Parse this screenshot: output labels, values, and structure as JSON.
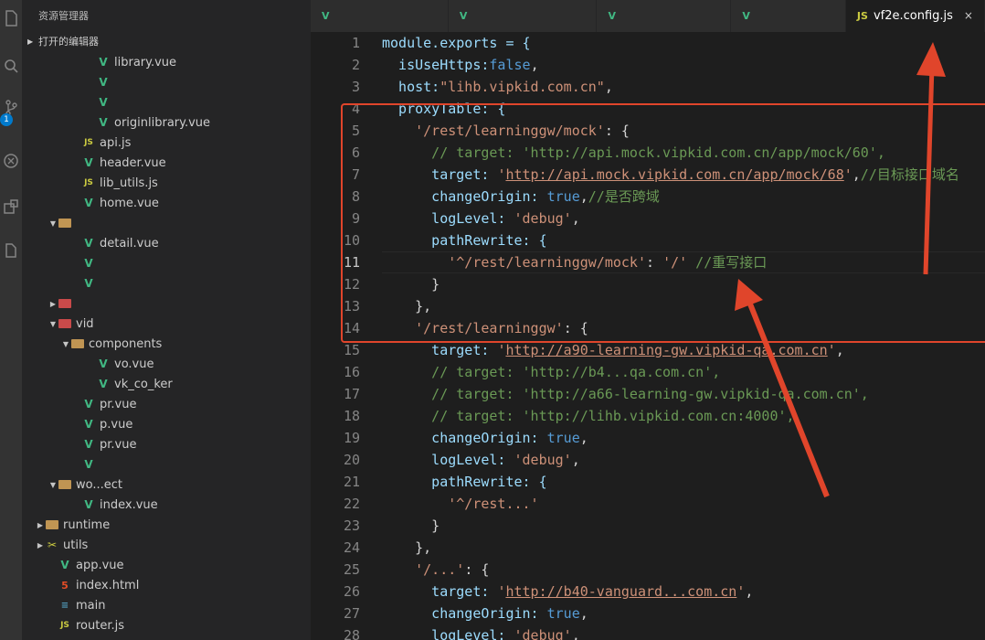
{
  "explorer": {
    "title": "资源管理器",
    "open_editors": "打开的编辑器",
    "tree": [
      {
        "label": "library.vue",
        "indent": 84,
        "icon": "vue",
        "twisty": ""
      },
      {
        "label": "",
        "indent": 84,
        "icon": "vue",
        "twisty": ""
      },
      {
        "label": "",
        "indent": 84,
        "icon": "vue",
        "twisty": ""
      },
      {
        "label": "originlibrary.vue",
        "indent": 84,
        "icon": "vue",
        "twisty": ""
      },
      {
        "label": "api.js",
        "indent": 68,
        "icon": "js",
        "twisty": ""
      },
      {
        "label": "header.vue",
        "indent": 68,
        "icon": "vue",
        "twisty": ""
      },
      {
        "label": "lib_utils.js",
        "indent": 68,
        "icon": "js",
        "twisty": ""
      },
      {
        "label": "home.vue",
        "indent": 68,
        "icon": "vue",
        "twisty": ""
      },
      {
        "label": "",
        "indent": 42,
        "icon": "folder",
        "twisty": "▼"
      },
      {
        "label": "detail.vue",
        "indent": 68,
        "icon": "vue",
        "twisty": ""
      },
      {
        "label": "",
        "indent": 68,
        "icon": "vue",
        "twisty": ""
      },
      {
        "label": "",
        "indent": 68,
        "icon": "vue",
        "twisty": ""
      },
      {
        "label": "",
        "indent": 42,
        "icon": "folder-red",
        "twisty": "▶"
      },
      {
        "label": "vid",
        "indent": 42,
        "icon": "folder-red",
        "twisty": "▼"
      },
      {
        "label": "components",
        "indent": 56,
        "icon": "folder",
        "twisty": "▼"
      },
      {
        "label": "vo.vue",
        "indent": 84,
        "icon": "vue",
        "twisty": ""
      },
      {
        "label": "vk_co_ker",
        "indent": 84,
        "icon": "vue",
        "twisty": ""
      },
      {
        "label": "pr.vue",
        "indent": 68,
        "icon": "vue",
        "twisty": ""
      },
      {
        "label": "p.vue",
        "indent": 68,
        "icon": "vue",
        "twisty": ""
      },
      {
        "label": "pr.vue",
        "indent": 68,
        "icon": "vue",
        "twisty": ""
      },
      {
        "label": "",
        "indent": 68,
        "icon": "vue",
        "twisty": ""
      },
      {
        "label": "wo...ect",
        "indent": 42,
        "icon": "folder",
        "twisty": "▼"
      },
      {
        "label": "index.vue",
        "indent": 68,
        "icon": "vue",
        "twisty": ""
      },
      {
        "label": "runtime",
        "indent": 28,
        "icon": "folder",
        "twisty": "▶"
      },
      {
        "label": "utils",
        "indent": 28,
        "icon": "tool",
        "twisty": "▶"
      },
      {
        "label": "app.vue",
        "indent": 42,
        "icon": "vue",
        "twisty": ""
      },
      {
        "label": "index.html",
        "indent": 42,
        "icon": "html",
        "twisty": ""
      },
      {
        "label": "main",
        "indent": 42,
        "icon": "md",
        "twisty": ""
      },
      {
        "label": "router.js",
        "indent": 42,
        "icon": "js",
        "twisty": ""
      }
    ]
  },
  "activity_bar": {
    "icons": [
      "files-icon",
      "search-icon",
      "source-control-icon",
      "debug-icon",
      "extensions-icon",
      "remote-icon"
    ],
    "scm_badge": "1"
  },
  "tabs": [
    {
      "label": "",
      "icon": "vue",
      "active": false
    },
    {
      "label": "",
      "icon": "vue",
      "active": false
    },
    {
      "label": "",
      "icon": "vue",
      "active": false
    },
    {
      "label": "",
      "icon": "vue",
      "active": false
    },
    {
      "label": "vf2e.config.js",
      "icon": "js",
      "active": true,
      "close": "×"
    }
  ],
  "editor": {
    "active_line": 11,
    "line_numbers": [
      "1",
      "2",
      "3",
      "4",
      "5",
      "6",
      "7",
      "8",
      "9",
      "10",
      "11",
      "12",
      "13",
      "14",
      "15",
      "16",
      "17",
      "18",
      "19",
      "20",
      "21",
      "22",
      "23",
      "24",
      "25",
      "26",
      "27",
      "28"
    ],
    "lines": [
      [
        {
          "t": "module.exports = {",
          "c": "k"
        }
      ],
      [
        {
          "t": "  isUseHttps:",
          "c": "k"
        },
        {
          "t": "false",
          "c": "b"
        },
        {
          "t": ",",
          "c": "p"
        }
      ],
      [
        {
          "t": "  host:",
          "c": "k"
        },
        {
          "t": "\"lihb.vipkid.com.cn\"",
          "c": "s"
        },
        {
          "t": ",",
          "c": "p"
        }
      ],
      [
        {
          "t": "  proxyTable: {",
          "c": "k"
        }
      ],
      [
        {
          "t": "    ",
          "c": "p"
        },
        {
          "t": "'/rest/learninggw/mock'",
          "c": "s"
        },
        {
          "t": ": {",
          "c": "p"
        }
      ],
      [
        {
          "t": "      // target: 'http://api.mock.vipkid.com.cn/app/mock/60',",
          "c": "c"
        }
      ],
      [
        {
          "t": "      target: ",
          "c": "k"
        },
        {
          "t": "'",
          "c": "s"
        },
        {
          "t": "http://api.mock.vipkid.com.cn/app/mock/68",
          "c": "s u"
        },
        {
          "t": "'",
          "c": "s"
        },
        {
          "t": ",",
          "c": "p"
        },
        {
          "t": "//目标接口域名",
          "c": "c"
        }
      ],
      [
        {
          "t": "      changeOrigin: ",
          "c": "k"
        },
        {
          "t": "true",
          "c": "b"
        },
        {
          "t": ",",
          "c": "p"
        },
        {
          "t": "//是否跨域",
          "c": "c"
        }
      ],
      [
        {
          "t": "      logLevel: ",
          "c": "k"
        },
        {
          "t": "'debug'",
          "c": "s"
        },
        {
          "t": ",",
          "c": "p"
        }
      ],
      [
        {
          "t": "      pathRewrite: {",
          "c": "k"
        }
      ],
      [
        {
          "t": "        ",
          "c": "p"
        },
        {
          "t": "'^/rest/learninggw/mock'",
          "c": "s"
        },
        {
          "t": ": ",
          "c": "p"
        },
        {
          "t": "'/'",
          "c": "s"
        },
        {
          "t": " //重写接口",
          "c": "c"
        }
      ],
      [
        {
          "t": "      }",
          "c": "p"
        }
      ],
      [
        {
          "t": "    },",
          "c": "p"
        }
      ],
      [
        {
          "t": "    ",
          "c": "p"
        },
        {
          "t": "'/rest/learninggw'",
          "c": "s"
        },
        {
          "t": ": {",
          "c": "p"
        }
      ],
      [
        {
          "t": "      target: ",
          "c": "k"
        },
        {
          "t": "'",
          "c": "s"
        },
        {
          "t": "http://a90-learning-gw.vipkid-qa.com.cn",
          "c": "s u"
        },
        {
          "t": "'",
          "c": "s"
        },
        {
          "t": ",",
          "c": "p"
        }
      ],
      [
        {
          "t": "      // target: 'http://b4...qa.com.cn',",
          "c": "c"
        }
      ],
      [
        {
          "t": "      // target: 'http://a66-learning-gw.vipkid-qa.com.cn',",
          "c": "c"
        }
      ],
      [
        {
          "t": "      // target: 'http://lihb.vipkid.com.cn:4000',",
          "c": "c"
        }
      ],
      [
        {
          "t": "      changeOrigin: ",
          "c": "k"
        },
        {
          "t": "true",
          "c": "b"
        },
        {
          "t": ",",
          "c": "p"
        }
      ],
      [
        {
          "t": "      logLevel: ",
          "c": "k"
        },
        {
          "t": "'debug'",
          "c": "s"
        },
        {
          "t": ",",
          "c": "p"
        }
      ],
      [
        {
          "t": "      pathRewrite: {",
          "c": "k"
        }
      ],
      [
        {
          "t": "        ",
          "c": "p"
        },
        {
          "t": "'^/rest...'",
          "c": "s"
        }
      ],
      [
        {
          "t": "      }",
          "c": "p"
        }
      ],
      [
        {
          "t": "    },",
          "c": "p"
        }
      ],
      [
        {
          "t": "    ",
          "c": "p"
        },
        {
          "t": "'/...'",
          "c": "s"
        },
        {
          "t": ": {",
          "c": "p"
        }
      ],
      [
        {
          "t": "      target: ",
          "c": "k"
        },
        {
          "t": "'",
          "c": "s"
        },
        {
          "t": "http://b40-vanguard...com.cn",
          "c": "s u"
        },
        {
          "t": "'",
          "c": "s"
        },
        {
          "t": ",",
          "c": "p"
        }
      ],
      [
        {
          "t": "      changeOrigin: ",
          "c": "k"
        },
        {
          "t": "true",
          "c": "b"
        },
        {
          "t": ",",
          "c": "p"
        }
      ],
      [
        {
          "t": "      logLevel: ",
          "c": "k"
        },
        {
          "t": "'debug'",
          "c": "s"
        },
        {
          "t": ",",
          "c": "p"
        }
      ]
    ]
  },
  "annotation_color": "#e0452b"
}
